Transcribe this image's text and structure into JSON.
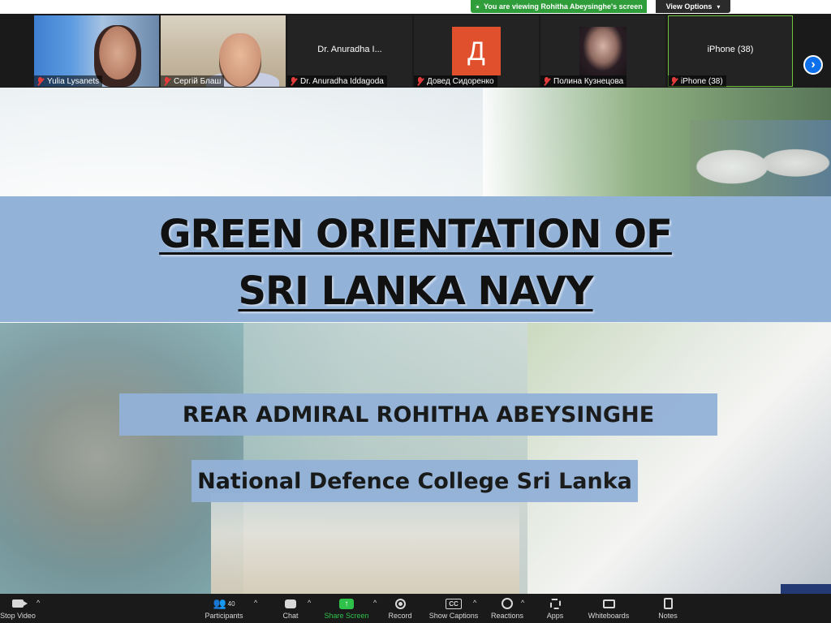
{
  "banner": {
    "viewing_text": "You are viewing Rohitha Abeysinghe's screen",
    "view_options_label": "View Options"
  },
  "participants": [
    {
      "name": "Yulia Lysanets",
      "display": "video"
    },
    {
      "name": "Сергій Блаш",
      "display": "video"
    },
    {
      "name": "Dr. Anuradha Iddagoda",
      "display": "name",
      "big_name": "Dr. Anuradha I..."
    },
    {
      "name": "Довед Сидоренко",
      "display": "avatar",
      "avatar_letter": "Д",
      "avatar_color": "#e0502c"
    },
    {
      "name": "Полина Кузнецова",
      "display": "avatar-photo"
    },
    {
      "name": "iPhone (38)",
      "display": "name",
      "big_name": "iPhone (38)",
      "active": true
    }
  ],
  "next_page_icon": "chevron-right-icon",
  "slide": {
    "title_line1": "GREEN ORIENTATION OF",
    "title_line2": "SRI LANKA NAVY",
    "presenter": "REAR ADMIRAL ROHITHA ABEYSINGHE",
    "institution": "National Defence College Sri Lanka",
    "band_color": "#93b2d8"
  },
  "toolbar": {
    "stop_video": "Stop Video",
    "participants": "Participants",
    "participants_count": "40",
    "chat": "Chat",
    "share_screen": "Share Screen",
    "record": "Record",
    "show_captions": "Show Captions",
    "captions_icon_text": "CC",
    "reactions": "Reactions",
    "apps": "Apps",
    "whiteboards": "Whiteboards",
    "notes": "Notes",
    "share_color": "#2ec24a"
  }
}
